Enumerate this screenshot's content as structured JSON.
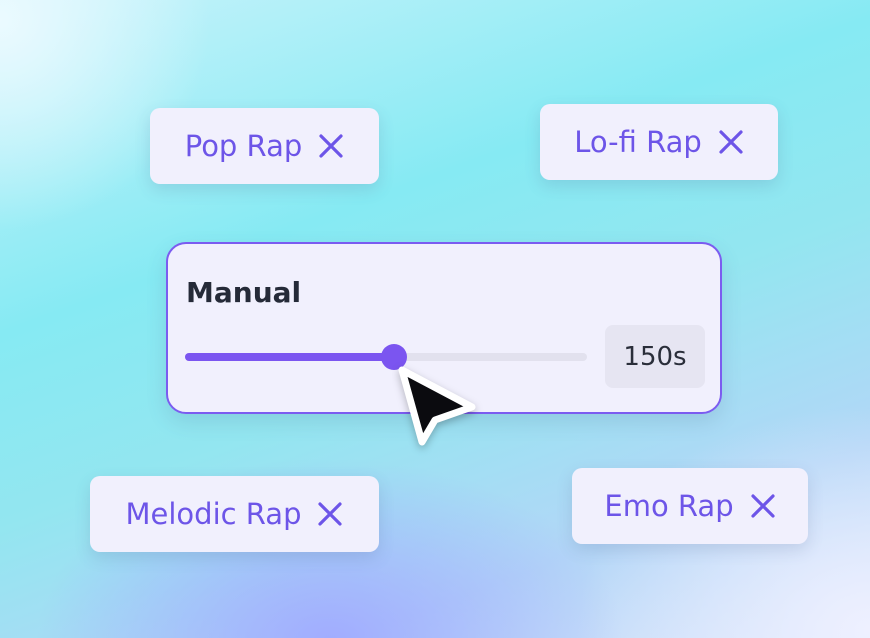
{
  "chips": {
    "pop_rap": "Pop Rap",
    "lofi_rap": "Lo-fi Rap",
    "melodic_rap": "Melodic Rap",
    "emo_rap": "Emo Rap",
    "remove_icon": "close-icon"
  },
  "manual_card": {
    "title": "Manual",
    "slider_fraction": 0.52,
    "value": "150s"
  },
  "colors": {
    "accent": "#7b55f0",
    "chip_bg": "#f1f0fd",
    "text_dark": "#252a38"
  },
  "cursor_icon": "mouse-pointer-icon"
}
